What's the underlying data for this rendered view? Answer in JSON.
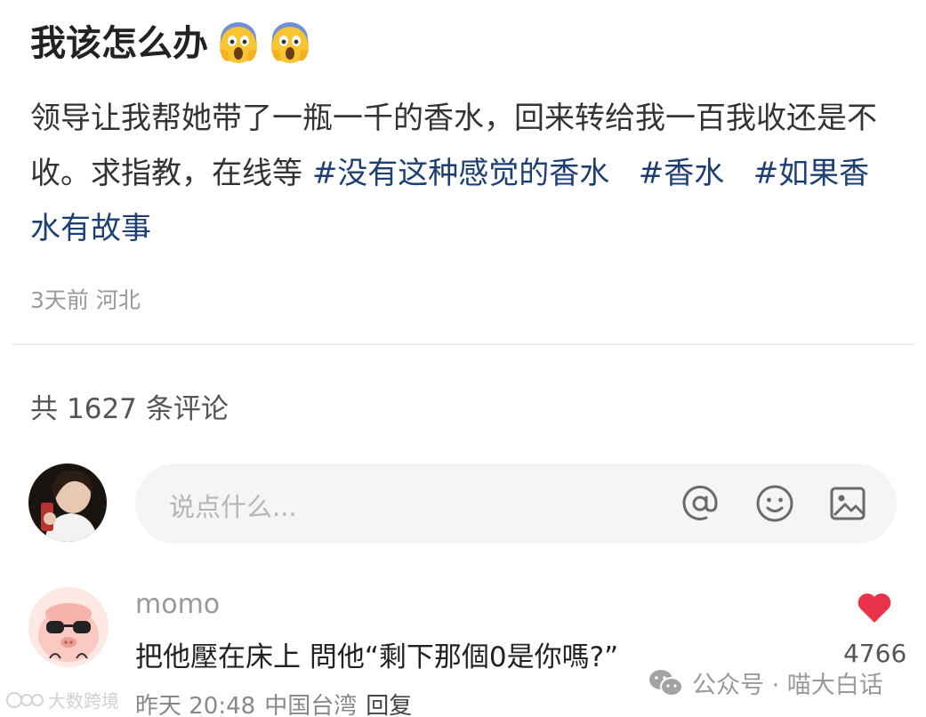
{
  "post": {
    "title": "我该怎么办",
    "title_emojis": [
      "face-screaming-in-fear",
      "face-screaming-in-fear"
    ],
    "body": "领导让我帮她带了一瓶一千的香水，回来转给我一百我收还是不收。求指教，在线等",
    "tags": [
      "#没有这种感觉的香水",
      "#香水",
      "#如果香水有故事"
    ],
    "time": "3天前",
    "location": "河北"
  },
  "comments_header": {
    "prefix": "共",
    "count": "1627",
    "suffix": "条评论"
  },
  "input": {
    "placeholder": "说点什么...",
    "icons": [
      "at-icon",
      "emoji-icon",
      "image-icon"
    ]
  },
  "comment": {
    "username": "momo",
    "text": "把他壓在床上 問他“剩下那個0是你嗎?”",
    "time": "昨天 20:48",
    "location": "中国台湾",
    "reply_label": "回复",
    "likes": "4766"
  },
  "watermarks": {
    "left": "大数跨境",
    "right": "公众号 · 喵大白话"
  },
  "colors": {
    "tag": "#1d3f73",
    "like": "#e8334a",
    "input_bg": "#f4f5f6"
  }
}
